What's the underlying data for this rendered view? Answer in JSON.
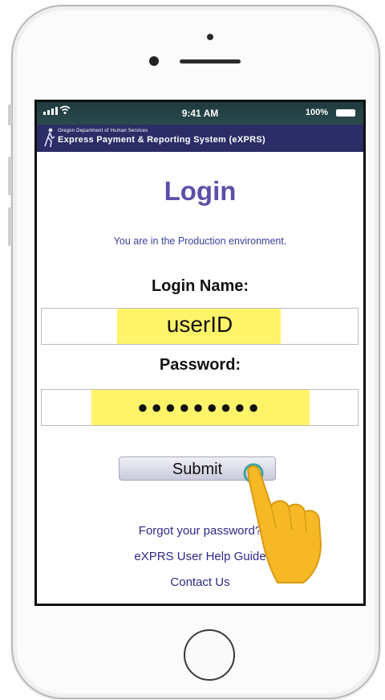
{
  "status_bar": {
    "time": "9:41 AM",
    "battery": "100%"
  },
  "banner": {
    "agency": "Oregon Department of Human Services",
    "system": "Express Payment & Reporting System (eXPRS)"
  },
  "login": {
    "title": "Login",
    "environment_notice": "You are in the Production environment.",
    "username_label": "Login Name:",
    "username_value": "userID",
    "password_label": "Password:",
    "password_value": "●●●●●●●●●",
    "submit_label": "Submit"
  },
  "links": {
    "forgot_password": "Forgot your password?",
    "help_guide": "eXPRS User Help Guide",
    "contact": "Contact Us"
  },
  "colors": {
    "banner_bg": "#2c2d66",
    "title": "#5b4fa8",
    "highlight": "#fff36a",
    "hand": "#f6b825"
  }
}
